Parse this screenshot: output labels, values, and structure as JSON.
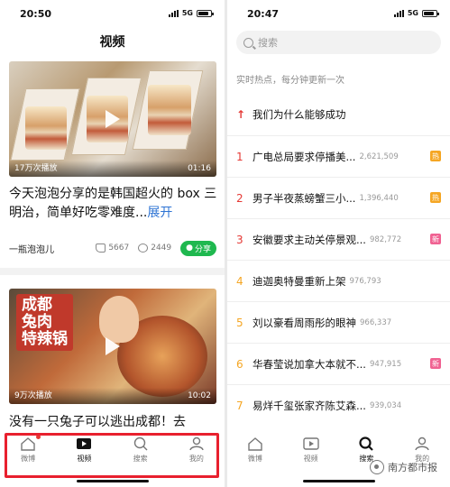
{
  "left": {
    "status": {
      "time": "20:50",
      "network": "5G"
    },
    "title": "视频",
    "videos": [
      {
        "views": "17万次播放",
        "duration": "01:16",
        "caption": "今天泡泡分享的是韩国超火的 box 三明治，简单好吃零难度...",
        "more": "展开",
        "author": "一瓶泡泡儿",
        "likes": "5667",
        "comments": "2449",
        "share": "分享"
      },
      {
        "views": "9万次播放",
        "duration": "10:02",
        "overlay": [
          "成都",
          "兔肉",
          "特辣锅"
        ],
        "caption": "没有一只兔子可以逃出成都！去"
      }
    ],
    "tabs": [
      {
        "label": "微博",
        "icon": "home-icon"
      },
      {
        "label": "视频",
        "icon": "video-icon"
      },
      {
        "label": "搜索",
        "icon": "search-icon"
      },
      {
        "label": "我的",
        "icon": "profile-icon"
      }
    ]
  },
  "right": {
    "status": {
      "time": "20:47",
      "network": "5G"
    },
    "search_placeholder": "搜索",
    "hot_header": "实时热点，每分钟更新一次",
    "pinned": {
      "title": "我们为什么能够成功"
    },
    "hot": [
      {
        "rank": "1",
        "title": "广电总局要求停播美...",
        "count": "2,621,509",
        "badge": "热",
        "rank_color": "#e53935",
        "badge_color": "#f5a623"
      },
      {
        "rank": "2",
        "title": "男子半夜蒸螃蟹三小...",
        "count": "1,396,440",
        "badge": "热",
        "rank_color": "#e53935",
        "badge_color": "#f5a623"
      },
      {
        "rank": "3",
        "title": "安徽要求主动关停景观...",
        "count": "982,772",
        "badge": "新",
        "rank_color": "#e53935",
        "badge_color": "#f06292"
      },
      {
        "rank": "4",
        "title": "迪迦奥特曼重新上架",
        "count": "976,793",
        "badge": "",
        "rank_color": "#f5a623",
        "badge_color": ""
      },
      {
        "rank": "5",
        "title": "刘以豪看周雨彤的眼神",
        "count": "966,337",
        "badge": "",
        "rank_color": "#f5a623",
        "badge_color": ""
      },
      {
        "rank": "6",
        "title": "华春莹说加拿大本就不...",
        "count": "947,915",
        "badge": "新",
        "rank_color": "#f5a623",
        "badge_color": "#f06292"
      },
      {
        "rank": "7",
        "title": "易烊千玺张家齐陈艾森...",
        "count": "939,034",
        "badge": "",
        "rank_color": "#f5a623",
        "badge_color": ""
      }
    ],
    "tabs": [
      {
        "label": "微博",
        "icon": "home-icon"
      },
      {
        "label": "视频",
        "icon": "video-icon"
      },
      {
        "label": "搜索",
        "icon": "search-icon"
      },
      {
        "label": "我的",
        "icon": "profile-icon"
      }
    ],
    "watermark": "南方都市报"
  }
}
